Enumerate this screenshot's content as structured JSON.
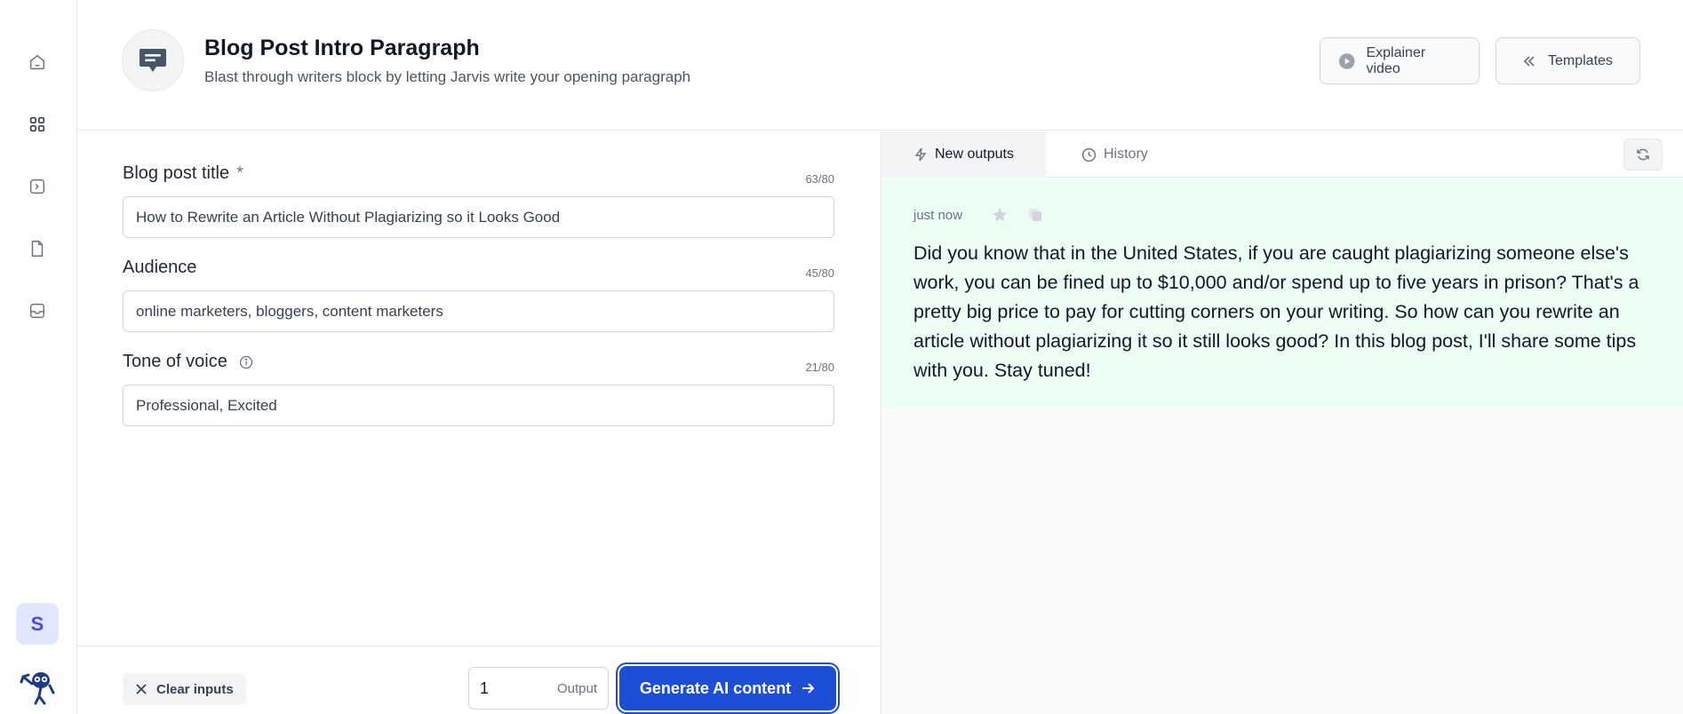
{
  "sidebar": {
    "items": [
      {
        "name": "home"
      },
      {
        "name": "templates"
      },
      {
        "name": "commands"
      },
      {
        "name": "documents"
      },
      {
        "name": "inbox"
      }
    ],
    "avatar_initial": "S"
  },
  "header": {
    "title": "Blog Post Intro Paragraph",
    "subtitle": "Blast through writers block by letting Jarvis write your opening paragraph",
    "explainer_label": "Explainer video",
    "templates_label": "Templates"
  },
  "form": {
    "fields": [
      {
        "label": "Blog post title",
        "required_mark": "*",
        "counter": "63/80",
        "value": "How to Rewrite an Article Without Plagiarizing so it Looks Good"
      },
      {
        "label": "Audience",
        "counter": "45/80",
        "value": "online marketers, bloggers, content marketers"
      },
      {
        "label": "Tone of voice",
        "counter": "21/80",
        "value": "Professional, Excited"
      }
    ]
  },
  "bottom": {
    "clear_label": "Clear inputs",
    "output_count": "1",
    "output_label": "Output",
    "generate_label": "Generate AI content"
  },
  "outputs": {
    "tabs": [
      {
        "label": "New outputs",
        "active": true
      },
      {
        "label": "History",
        "active": false
      }
    ],
    "items": [
      {
        "timestamp": "just now",
        "text": "Did you know that in the United States, if you are caught plagiarizing someone else's work, you can be fined up to $10,000 and/or spend up to five years in prison? That's a pretty big price to pay for cutting corners on your writing. So how can you rewrite an article without plagiarizing it so it still looks good? In this blog post, I'll share some tips with you. Stay tuned!"
      }
    ]
  },
  "colors": {
    "accent": "#1d4ed8",
    "output_bg": "#ecfdf3",
    "avatar_bg": "#e0e7ff"
  }
}
